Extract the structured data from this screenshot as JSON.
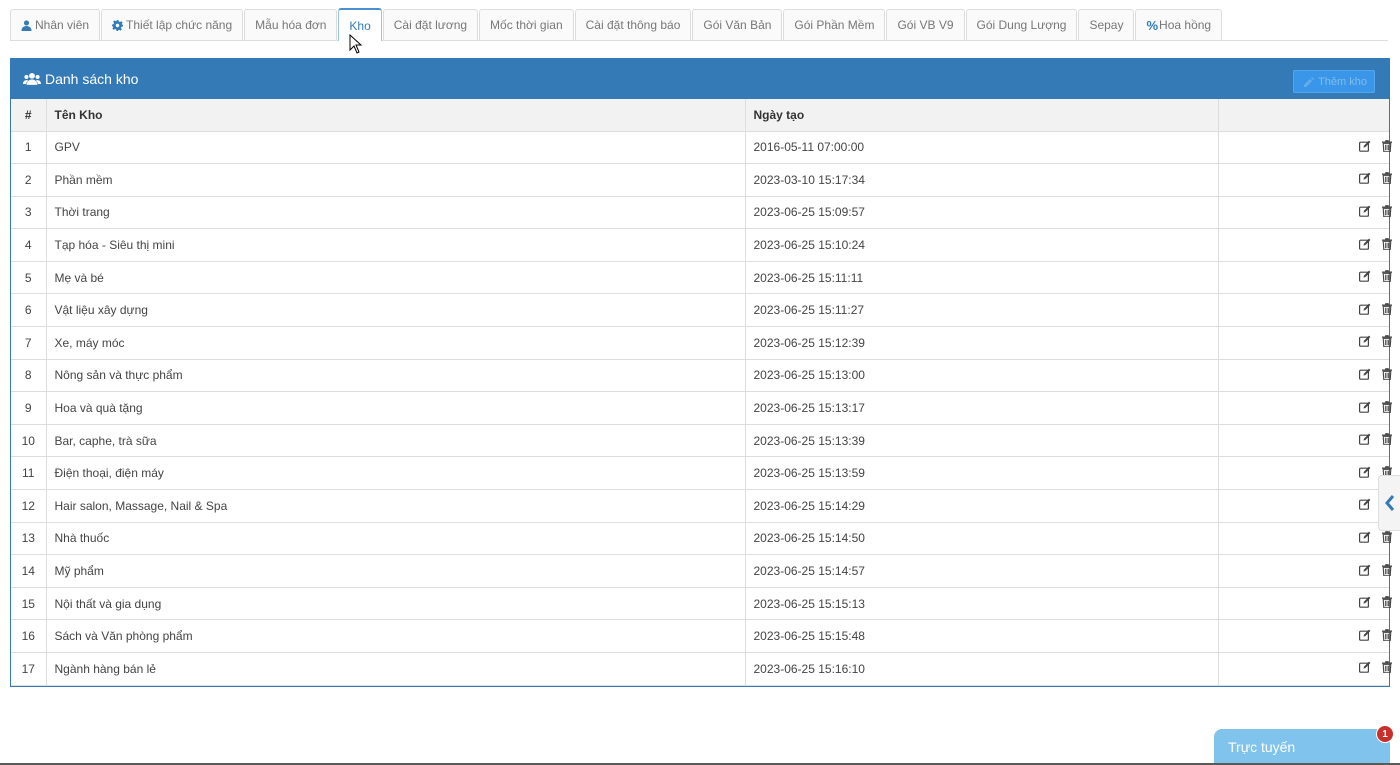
{
  "tabs": [
    {
      "label": "Nhân viên",
      "icon": "user-icon"
    },
    {
      "label": "Thiết lập chức năng",
      "icon": "gear-icon"
    },
    {
      "label": "Mẫu hóa đơn"
    },
    {
      "label": "Kho",
      "active": true
    },
    {
      "label": "Cài đặt lương"
    },
    {
      "label": "Mốc thời gian"
    },
    {
      "label": "Cài đặt thông báo"
    },
    {
      "label": "Gói Văn Bản"
    },
    {
      "label": "Gói Phần Mềm"
    },
    {
      "label": "Gói VB V9"
    },
    {
      "label": "Gói Dung Lượng"
    },
    {
      "label": "Sepay"
    },
    {
      "label": "Hoa hồng",
      "icon": "percent-icon"
    }
  ],
  "panel": {
    "title": "Danh sách kho",
    "add_button": "Thêm kho",
    "columns": {
      "index": "#",
      "name": "Tên Kho",
      "created": "Ngày tạo",
      "actions": ""
    }
  },
  "rows": [
    {
      "index": "1",
      "name": "GPV",
      "created": "2016-05-11 07:00:00"
    },
    {
      "index": "2",
      "name": "Phần mềm",
      "created": "2023-03-10 15:17:34"
    },
    {
      "index": "3",
      "name": "Thời trang",
      "created": "2023-06-25 15:09:57"
    },
    {
      "index": "4",
      "name": "Tạp hóa - Siêu thị mini",
      "created": "2023-06-25 15:10:24"
    },
    {
      "index": "5",
      "name": "Mẹ và bé",
      "created": "2023-06-25 15:11:11"
    },
    {
      "index": "6",
      "name": "Vật liệu xây dựng",
      "created": "2023-06-25 15:11:27"
    },
    {
      "index": "7",
      "name": "Xe, máy móc",
      "created": "2023-06-25 15:12:39"
    },
    {
      "index": "8",
      "name": "Nông sản và thực phẩm",
      "created": "2023-06-25 15:13:00"
    },
    {
      "index": "9",
      "name": "Hoa và quà tặng",
      "created": "2023-06-25 15:13:17"
    },
    {
      "index": "10",
      "name": "Bar, caphe, trà sữa",
      "created": "2023-06-25 15:13:39"
    },
    {
      "index": "11",
      "name": "Điện thoại, điện máy",
      "created": "2023-06-25 15:13:59"
    },
    {
      "index": "12",
      "name": "Hair salon, Massage, Nail & Spa",
      "created": "2023-06-25 15:14:29"
    },
    {
      "index": "13",
      "name": "Nhà thuốc",
      "created": "2023-06-25 15:14:50"
    },
    {
      "index": "14",
      "name": "Mỹ phẩm",
      "created": "2023-06-25 15:14:57"
    },
    {
      "index": "15",
      "name": "Nội thất và gia dụng",
      "created": "2023-06-25 15:15:13"
    },
    {
      "index": "16",
      "name": "Sách và Văn phòng phẩm",
      "created": "2023-06-25 15:15:48"
    },
    {
      "index": "17",
      "name": "Ngành hàng bán lẻ",
      "created": "2023-06-25 15:16:10"
    }
  ],
  "chat": {
    "label": "Trực tuyến",
    "badge": "1"
  },
  "colors": {
    "primary": "#337ab7",
    "chat": "#80c3ec",
    "badge": "#c9302c"
  }
}
